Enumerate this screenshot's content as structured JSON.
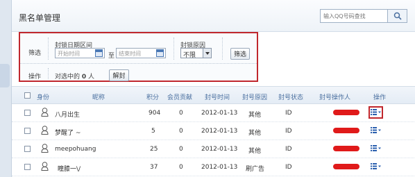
{
  "panel": {
    "title": "黑名单管理"
  },
  "search": {
    "placeholder": "输入QQ号码查找",
    "icon": "search-icon"
  },
  "filter": {
    "label": "筛选",
    "date_range_label": "封锁日期区间",
    "start_placeholder": "开始时间",
    "end_placeholder": "结束时间",
    "to": "至",
    "reason_label": "封锁原因",
    "reason_value": "不限",
    "filter_button": "筛选"
  },
  "operation": {
    "label": "操作",
    "selected_prefix": "对选中的",
    "selected_count": "0",
    "selected_suffix": "人",
    "unblock_button": "解封"
  },
  "table": {
    "headers": {
      "identity": "身份",
      "nickname": "昵称",
      "points": "积分",
      "contribution": "会员贡献",
      "ban_time": "封号时间",
      "ban_reason": "封号原因",
      "ban_status": "封号状态",
      "operator": "封号操作人",
      "action": "操作"
    },
    "rows": [
      {
        "nickname": "八月出生",
        "points": "904",
        "contribution": "0",
        "ban_time": "2012-01-13",
        "reason": "其他",
        "status": "ID"
      },
      {
        "nickname": "梦醒了 ~",
        "points": "5",
        "contribution": "0",
        "ban_time": "2012-01-13",
        "reason": "其他",
        "status": "ID"
      },
      {
        "nickname": "meepohuang",
        "points": "25",
        "contribution": "0",
        "ban_time": "2012-01-13",
        "reason": "其他",
        "status": "ID"
      },
      {
        "nickname": "瞳膝一\\/",
        "points": "37",
        "contribution": "0",
        "ban_time": "2012-01-13",
        "reason": "刷广告",
        "status": "ID"
      }
    ]
  },
  "colors": {
    "highlight": "#c0272d",
    "redaction": "#e01a1a",
    "header_text": "#4a6f9f",
    "icon_blue": "#2a5fae"
  }
}
